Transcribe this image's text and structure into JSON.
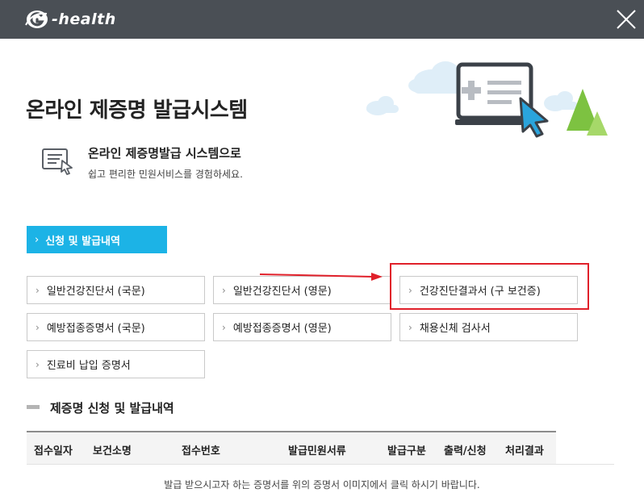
{
  "header": {
    "logo_text": "-health",
    "logo_icon": "g-health-logo-icon",
    "close_icon": "close-icon"
  },
  "main": {
    "title": "온라인 제증명 발급시스템",
    "intro_title": "온라인 제증명발급 시스템으로",
    "intro_subtitle": "쉽고 편리한 민원서비스를 경험하세요."
  },
  "tabs": {
    "apply_label": "신청 및 발급내역"
  },
  "certificates": [
    "일반건강진단서 (국문)",
    "일반건강진단서 (영문)",
    "건강진단결과서 (구 보건증)",
    "예방접종증명서 (국문)",
    "예방접종증명서 (영문)",
    "채용신체 검사서",
    "진료비 납입 증명서"
  ],
  "history": {
    "section_title": "제증명 신청 및 발급내역",
    "columns": [
      "접수일자",
      "보건소명",
      "접수번호",
      "발급민원서류",
      "발급구분",
      "출력/신청",
      "처리결과"
    ],
    "empty_message": "발급 받으시고자 하는 증명서를 위의 증명서 이미지에서 클릭 하시기 바랍니다."
  },
  "colors": {
    "header_bg": "#4a4f55",
    "accent": "#1cb3e6",
    "highlight": "#e0202a"
  }
}
